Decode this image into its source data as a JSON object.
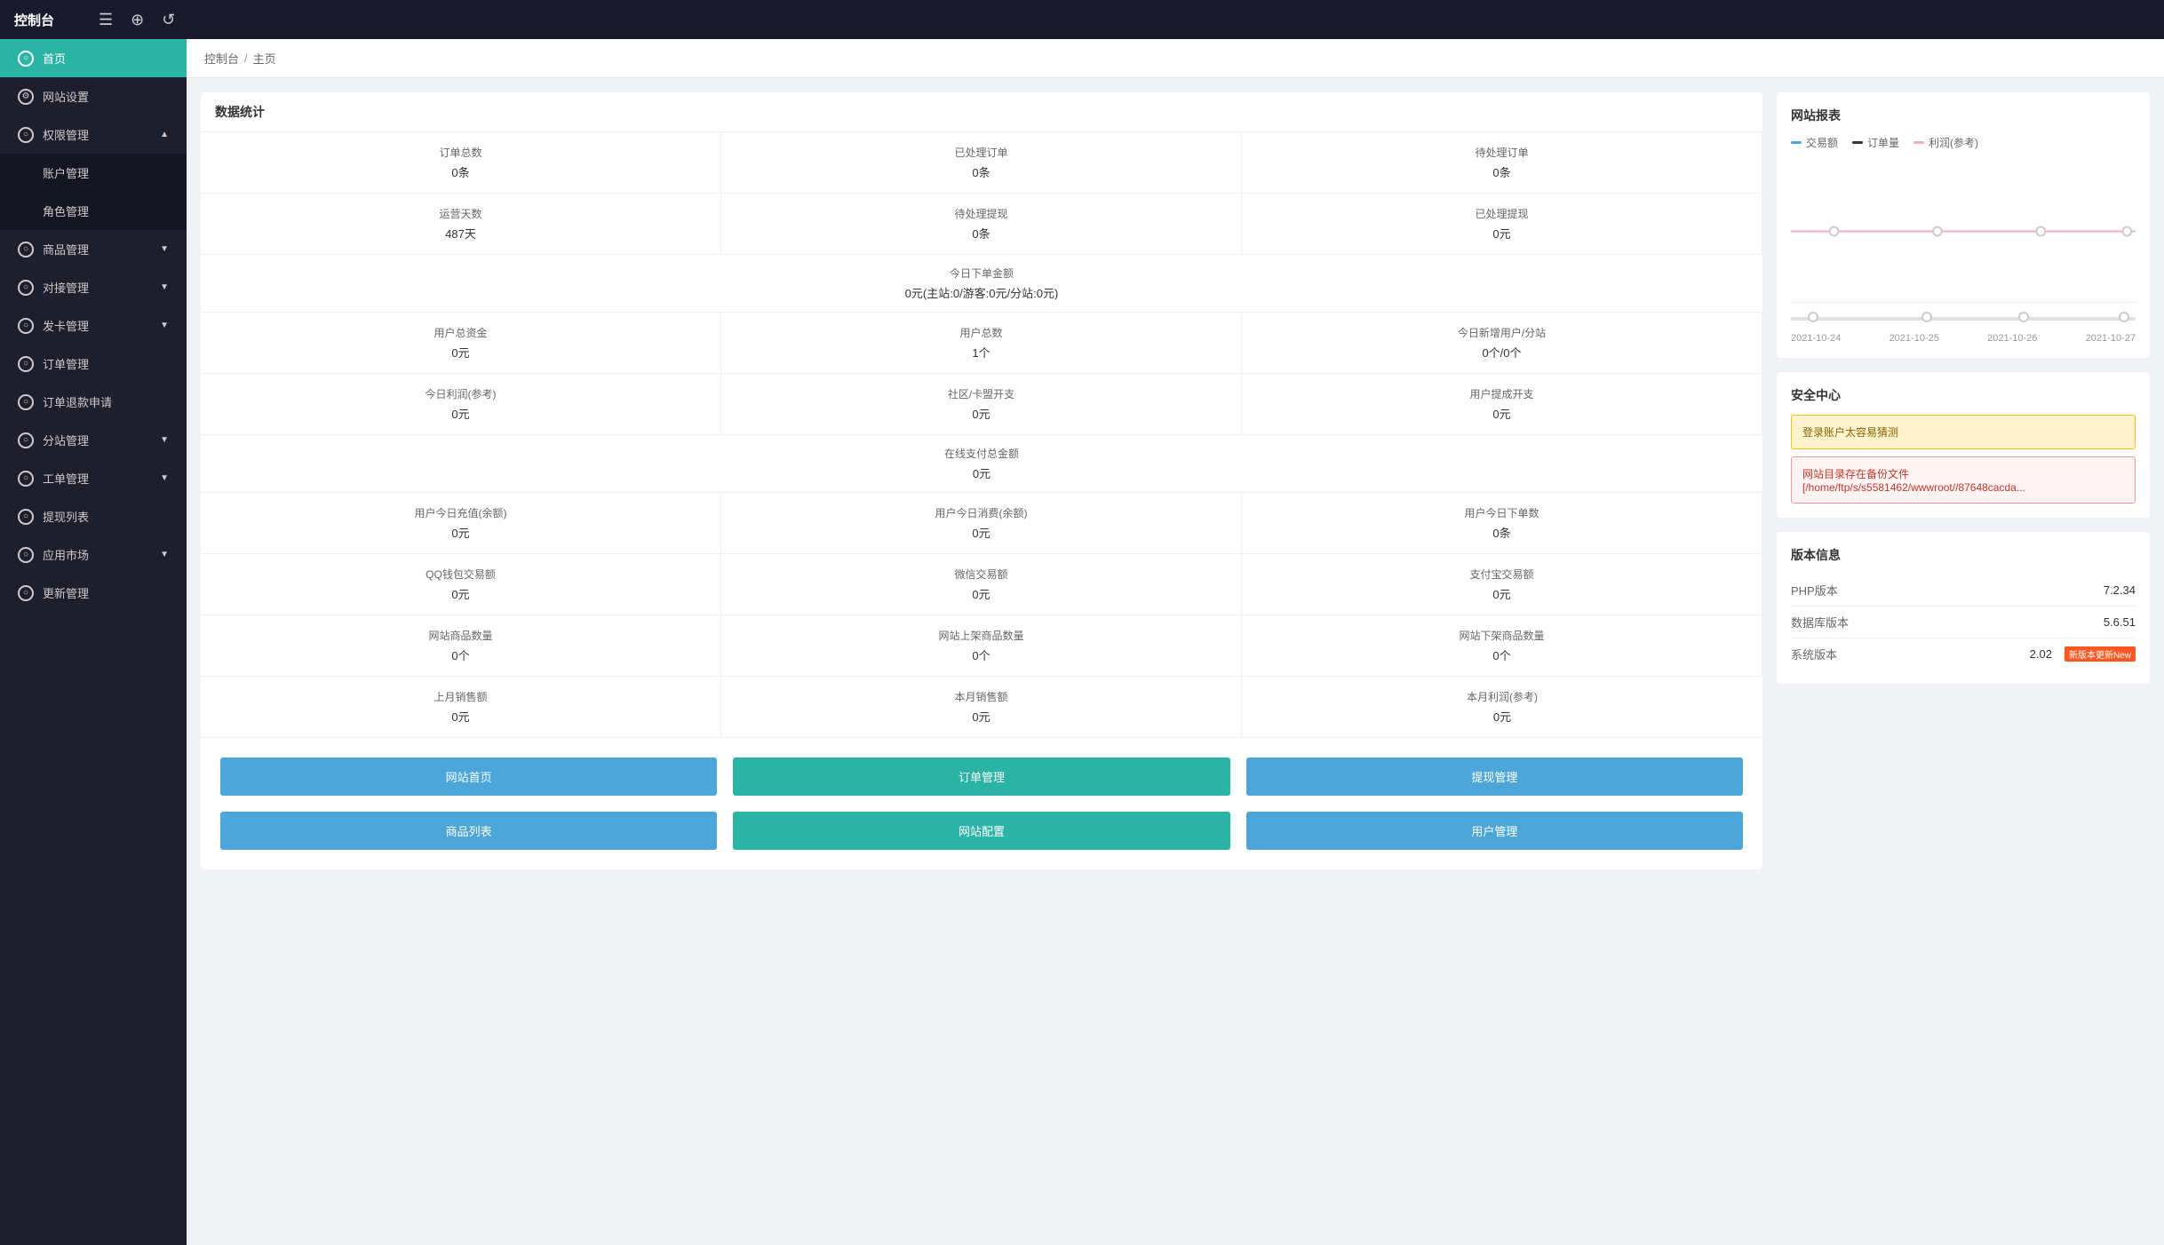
{
  "topbar": {
    "title": "控制台",
    "icon_menu": "☰",
    "icon_globe": "⊕",
    "icon_refresh": "↺"
  },
  "breadcrumb": {
    "items": [
      "控制台",
      "主页"
    ],
    "separator": "/"
  },
  "sidebar": {
    "items": [
      {
        "id": "home",
        "label": "首页",
        "active": true,
        "icon": "○"
      },
      {
        "id": "site-settings",
        "label": "网站设置",
        "active": false,
        "icon": "⚙",
        "has_arrow": false
      },
      {
        "id": "access-mgmt",
        "label": "权限管理",
        "active": false,
        "icon": "○",
        "has_arrow": true,
        "expanded": true
      },
      {
        "id": "account-mgmt",
        "label": "账户管理",
        "sub": true
      },
      {
        "id": "role-mgmt",
        "label": "角色管理",
        "sub": true
      },
      {
        "id": "product-mgmt",
        "label": "商品管理",
        "active": false,
        "icon": "○",
        "has_arrow": true
      },
      {
        "id": "connect-mgmt",
        "label": "对接管理",
        "active": false,
        "icon": "○",
        "has_arrow": true
      },
      {
        "id": "card-mgmt",
        "label": "发卡管理",
        "active": false,
        "icon": "○",
        "has_arrow": true
      },
      {
        "id": "order-mgmt",
        "label": "订单管理",
        "active": false,
        "icon": "○",
        "has_arrow": false
      },
      {
        "id": "refund-mgmt",
        "label": "订单退款申请",
        "active": false,
        "icon": "○",
        "has_arrow": false
      },
      {
        "id": "subsite-mgmt",
        "label": "分站管理",
        "active": false,
        "icon": "○",
        "has_arrow": true
      },
      {
        "id": "task-mgmt",
        "label": "工单管理",
        "active": false,
        "icon": "○",
        "has_arrow": true
      },
      {
        "id": "withdraw-list",
        "label": "提现列表",
        "active": false,
        "icon": "○",
        "has_arrow": false
      },
      {
        "id": "app-market",
        "label": "应用市场",
        "active": false,
        "icon": "○",
        "has_arrow": true
      },
      {
        "id": "update-mgmt",
        "label": "更新管理",
        "active": false,
        "icon": "○",
        "has_arrow": false
      }
    ]
  },
  "stats": {
    "title": "数据统计",
    "cells": [
      {
        "label": "订单总数",
        "value": "0条"
      },
      {
        "label": "已处理订单",
        "value": "0条"
      },
      {
        "label": "待处理订单",
        "value": "0条"
      },
      {
        "label": "运营天数",
        "value": "487天"
      },
      {
        "label": "待处理提现",
        "value": "0条"
      },
      {
        "label": "已处理提现",
        "value": "0元"
      },
      {
        "label": "今日下单金额",
        "value": "0元(主站:0/游客:0元/分站:0元)",
        "full": true
      },
      {
        "label": "用户总资金",
        "value": "0元"
      },
      {
        "label": "用户总数",
        "value": "1个"
      },
      {
        "label": "今日新增用户/分站",
        "value": "0个/0个"
      },
      {
        "label": "今日利润(参考)",
        "value": "0元"
      },
      {
        "label": "社区/卡盟开支",
        "value": "0元"
      },
      {
        "label": "用户提成开支",
        "value": "0元"
      },
      {
        "label": "在线支付总金额",
        "value": "0元",
        "full": true
      },
      {
        "label": "用户今日充值(余额)",
        "value": "0元"
      },
      {
        "label": "用户今日消费(余额)",
        "value": "0元"
      },
      {
        "label": "用户今日下单数",
        "value": "0条"
      },
      {
        "label": "QQ钱包交易额",
        "value": "0元"
      },
      {
        "label": "微信交易额",
        "value": "0元"
      },
      {
        "label": "支付宝交易额",
        "value": "0元"
      },
      {
        "label": "网站商品数量",
        "value": "0个"
      },
      {
        "label": "网站上架商品数量",
        "value": "0个"
      },
      {
        "label": "网站下架商品数量",
        "value": "0个"
      },
      {
        "label": "上月销售额",
        "value": "0元"
      },
      {
        "label": "本月销售额",
        "value": "0元"
      },
      {
        "label": "本月利润(参考)",
        "value": "0元"
      }
    ],
    "buttons": [
      {
        "label": "网站首页",
        "color": "blue"
      },
      {
        "label": "订单管理",
        "color": "teal"
      },
      {
        "label": "提现管理",
        "color": "blue"
      },
      {
        "label": "商品列表",
        "color": "blue"
      },
      {
        "label": "网站配置",
        "color": "teal"
      },
      {
        "label": "用户管理",
        "color": "blue"
      }
    ]
  },
  "chart": {
    "title": "网站报表",
    "legend": [
      {
        "label": "交易额",
        "color": "#4da6d9"
      },
      {
        "label": "订单量",
        "color": "#333333"
      },
      {
        "label": "利润(参考)",
        "color": "#f9a8c9"
      }
    ],
    "x_labels": [
      "2021-10-24",
      "2021-10-25",
      "2021-10-26",
      "2021-10-27"
    ],
    "sliders": [
      0.1,
      0.4,
      0.7,
      1.0
    ]
  },
  "security": {
    "title": "安全中心",
    "items": [
      {
        "text": "登录账户太容易猜测",
        "type": "warning"
      },
      {
        "text": "网站目录存在备份文件 [/home/ftp/s/s5581462/wwwroot//87648cacda...",
        "type": "danger"
      }
    ]
  },
  "version": {
    "title": "版本信息",
    "rows": [
      {
        "label": "PHP版本",
        "value": "7.2.34",
        "badge": null
      },
      {
        "label": "数据库版本",
        "value": "5.6.51",
        "badge": null
      },
      {
        "label": "系统版本",
        "value": "2.02",
        "badge": "新版本更新New"
      }
    ]
  }
}
